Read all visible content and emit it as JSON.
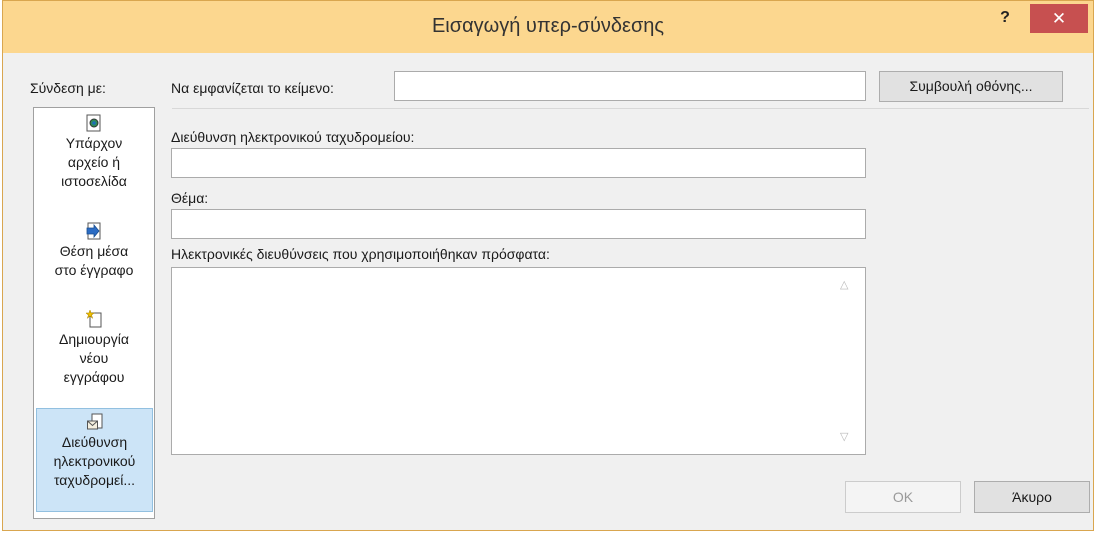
{
  "window": {
    "title": "Εισαγωγή υπερ-σύνδεσης",
    "help": "?",
    "close": "✕"
  },
  "link_to": {
    "label": "Σύνδεση με:",
    "items": [
      {
        "lines": [
          "Υπάρχον",
          "αρχείο ή",
          "ιστοσελίδα"
        ],
        "icon": "existing-file-icon",
        "selected": false
      },
      {
        "lines": [
          "Θέση μέσα",
          "στο έγγραφο"
        ],
        "icon": "place-in-document-icon",
        "selected": false
      },
      {
        "lines": [
          "Δημιουργία",
          "νέου",
          "εγγράφου"
        ],
        "icon": "new-document-icon",
        "selected": false
      },
      {
        "lines": [
          "Διεύθυνση",
          "ηλεκτρονικού",
          "ταχυδρομεί..."
        ],
        "icon": "email-address-icon",
        "selected": true
      }
    ]
  },
  "text_to_display": {
    "label": "Να εμφανίζεται το κείμενο:",
    "value": ""
  },
  "screentip_button": "Συμβουλή οθόνης...",
  "email_address": {
    "label": "Διεύθυνση ηλεκτρονικού ταχυδρομείου:",
    "value": ""
  },
  "subject": {
    "label": "Θέμα:",
    "value": ""
  },
  "recent": {
    "label": "Ηλεκτρονικές διευθύνσεις που χρησιμοποιήθηκαν πρόσφατα:",
    "items": []
  },
  "ok_button": "OK",
  "cancel_button": "Άκυρο",
  "colors": {
    "titlebar": "#fcd78f",
    "close": "#c75050",
    "selected": "#cce4f7"
  }
}
